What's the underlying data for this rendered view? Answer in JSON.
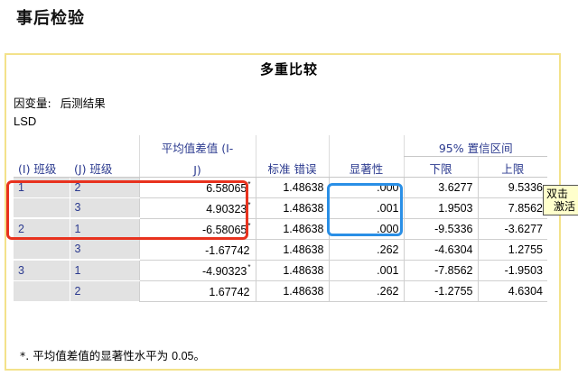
{
  "section_title": "事后检验",
  "table": {
    "title": "多重比较",
    "dependent_label": "因变量:",
    "dependent_value": "后测结果",
    "method": "LSD",
    "headers": {
      "i": "(I) 班级",
      "j": "(J) 班级",
      "mean_diff_line1": "平均值差值 (I-",
      "mean_diff_line2": "J)",
      "std_error": "标准 错误",
      "significance": "显著性",
      "ci": "95% 置信区间",
      "lower": "下限",
      "upper": "上限"
    },
    "rows": [
      {
        "i": "1",
        "j": "2",
        "mean_diff": "6.58065",
        "star": "*",
        "std_error": "1.48638",
        "sig": ".000",
        "lower": "3.6277",
        "upper": "9.5336"
      },
      {
        "i": "",
        "j": "3",
        "mean_diff": "4.90323",
        "star": "*",
        "std_error": "1.48638",
        "sig": ".001",
        "lower": "1.9503",
        "upper": "7.8562"
      },
      {
        "i": "2",
        "j": "1",
        "mean_diff": "-6.58065",
        "star": "*",
        "std_error": "1.48638",
        "sig": ".000",
        "lower": "-9.5336",
        "upper": "-3.6277"
      },
      {
        "i": "",
        "j": "3",
        "mean_diff": "-1.67742",
        "star": "",
        "std_error": "1.48638",
        "sig": ".262",
        "lower": "-4.6304",
        "upper": "1.2755"
      },
      {
        "i": "3",
        "j": "1",
        "mean_diff": "-4.90323",
        "star": "*",
        "std_error": "1.48638",
        "sig": ".001",
        "lower": "-7.8562",
        "upper": "-1.9503"
      },
      {
        "i": "",
        "j": "2",
        "mean_diff": "1.67742",
        "star": "",
        "std_error": "1.48638",
        "sig": ".262",
        "lower": "-1.2755",
        "upper": "4.6304"
      }
    ],
    "footnote_prefix": "*. 平均值差值的显著性水平为 ",
    "footnote_value": "0.05",
    "footnote_suffix": "。"
  },
  "tooltip": {
    "line1": "双击",
    "line2": "激活"
  },
  "colors": {
    "highlight_red": "#e8321e",
    "highlight_blue": "#2a8fe6",
    "panel_border": "#f3e28a",
    "header_text": "#2b3a8f",
    "label_bg": "#e2e2e2",
    "tooltip_bg": "#ffffcc"
  }
}
